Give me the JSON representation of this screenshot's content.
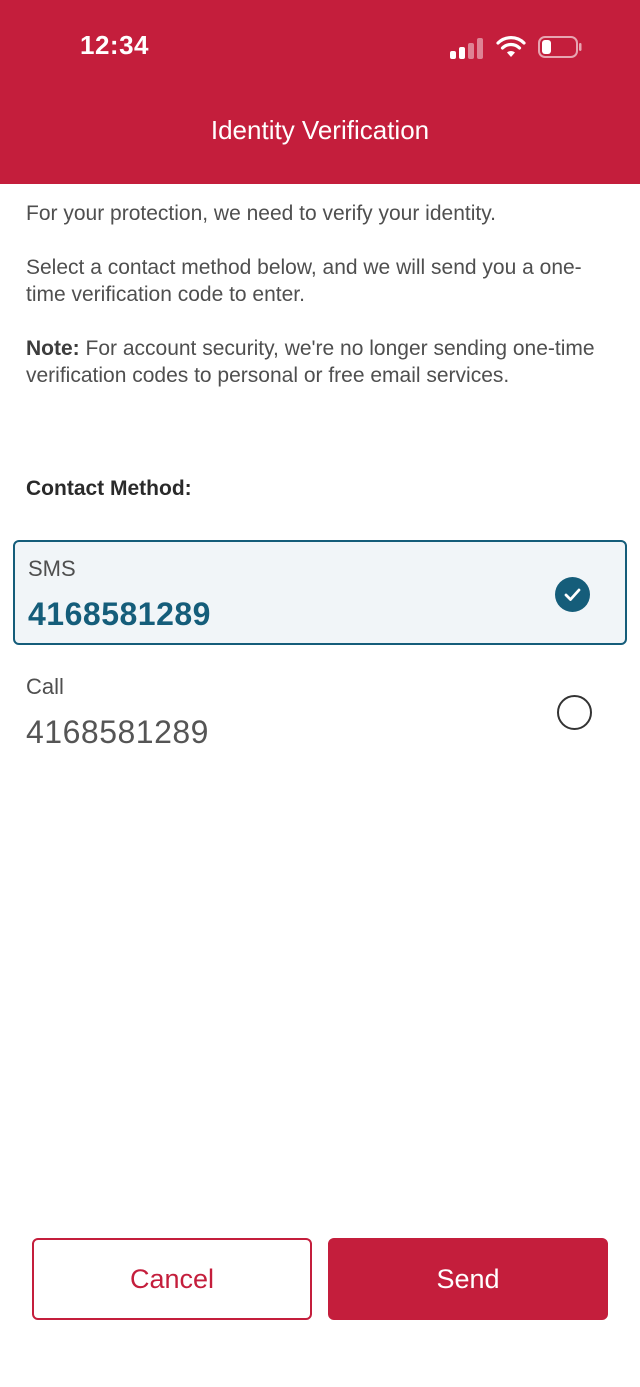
{
  "status_bar": {
    "time": "12:34",
    "icons": [
      "signal-icon",
      "wifi-icon",
      "battery-icon"
    ]
  },
  "header": {
    "title": "Identity Verification",
    "background_color": "#c41e3c"
  },
  "intro": {
    "paragraph1": "For your protection, we need to verify your identity.",
    "paragraph2": "Select a contact method below, and we will send you a one-time verification code to enter.",
    "note_label": "Note:",
    "note_text": " For account security, we're no longer sending one-time verification codes to personal or free email services."
  },
  "contact_method": {
    "heading": "Contact Method:",
    "options": [
      {
        "label": "SMS",
        "value": "4168581289",
        "selected": true
      },
      {
        "label": "Call",
        "value": "4168581289",
        "selected": false
      }
    ]
  },
  "actions": {
    "cancel_label": "Cancel",
    "send_label": "Send"
  },
  "colors": {
    "brand": "#c41e3c",
    "selected_accent": "#155d7a"
  }
}
